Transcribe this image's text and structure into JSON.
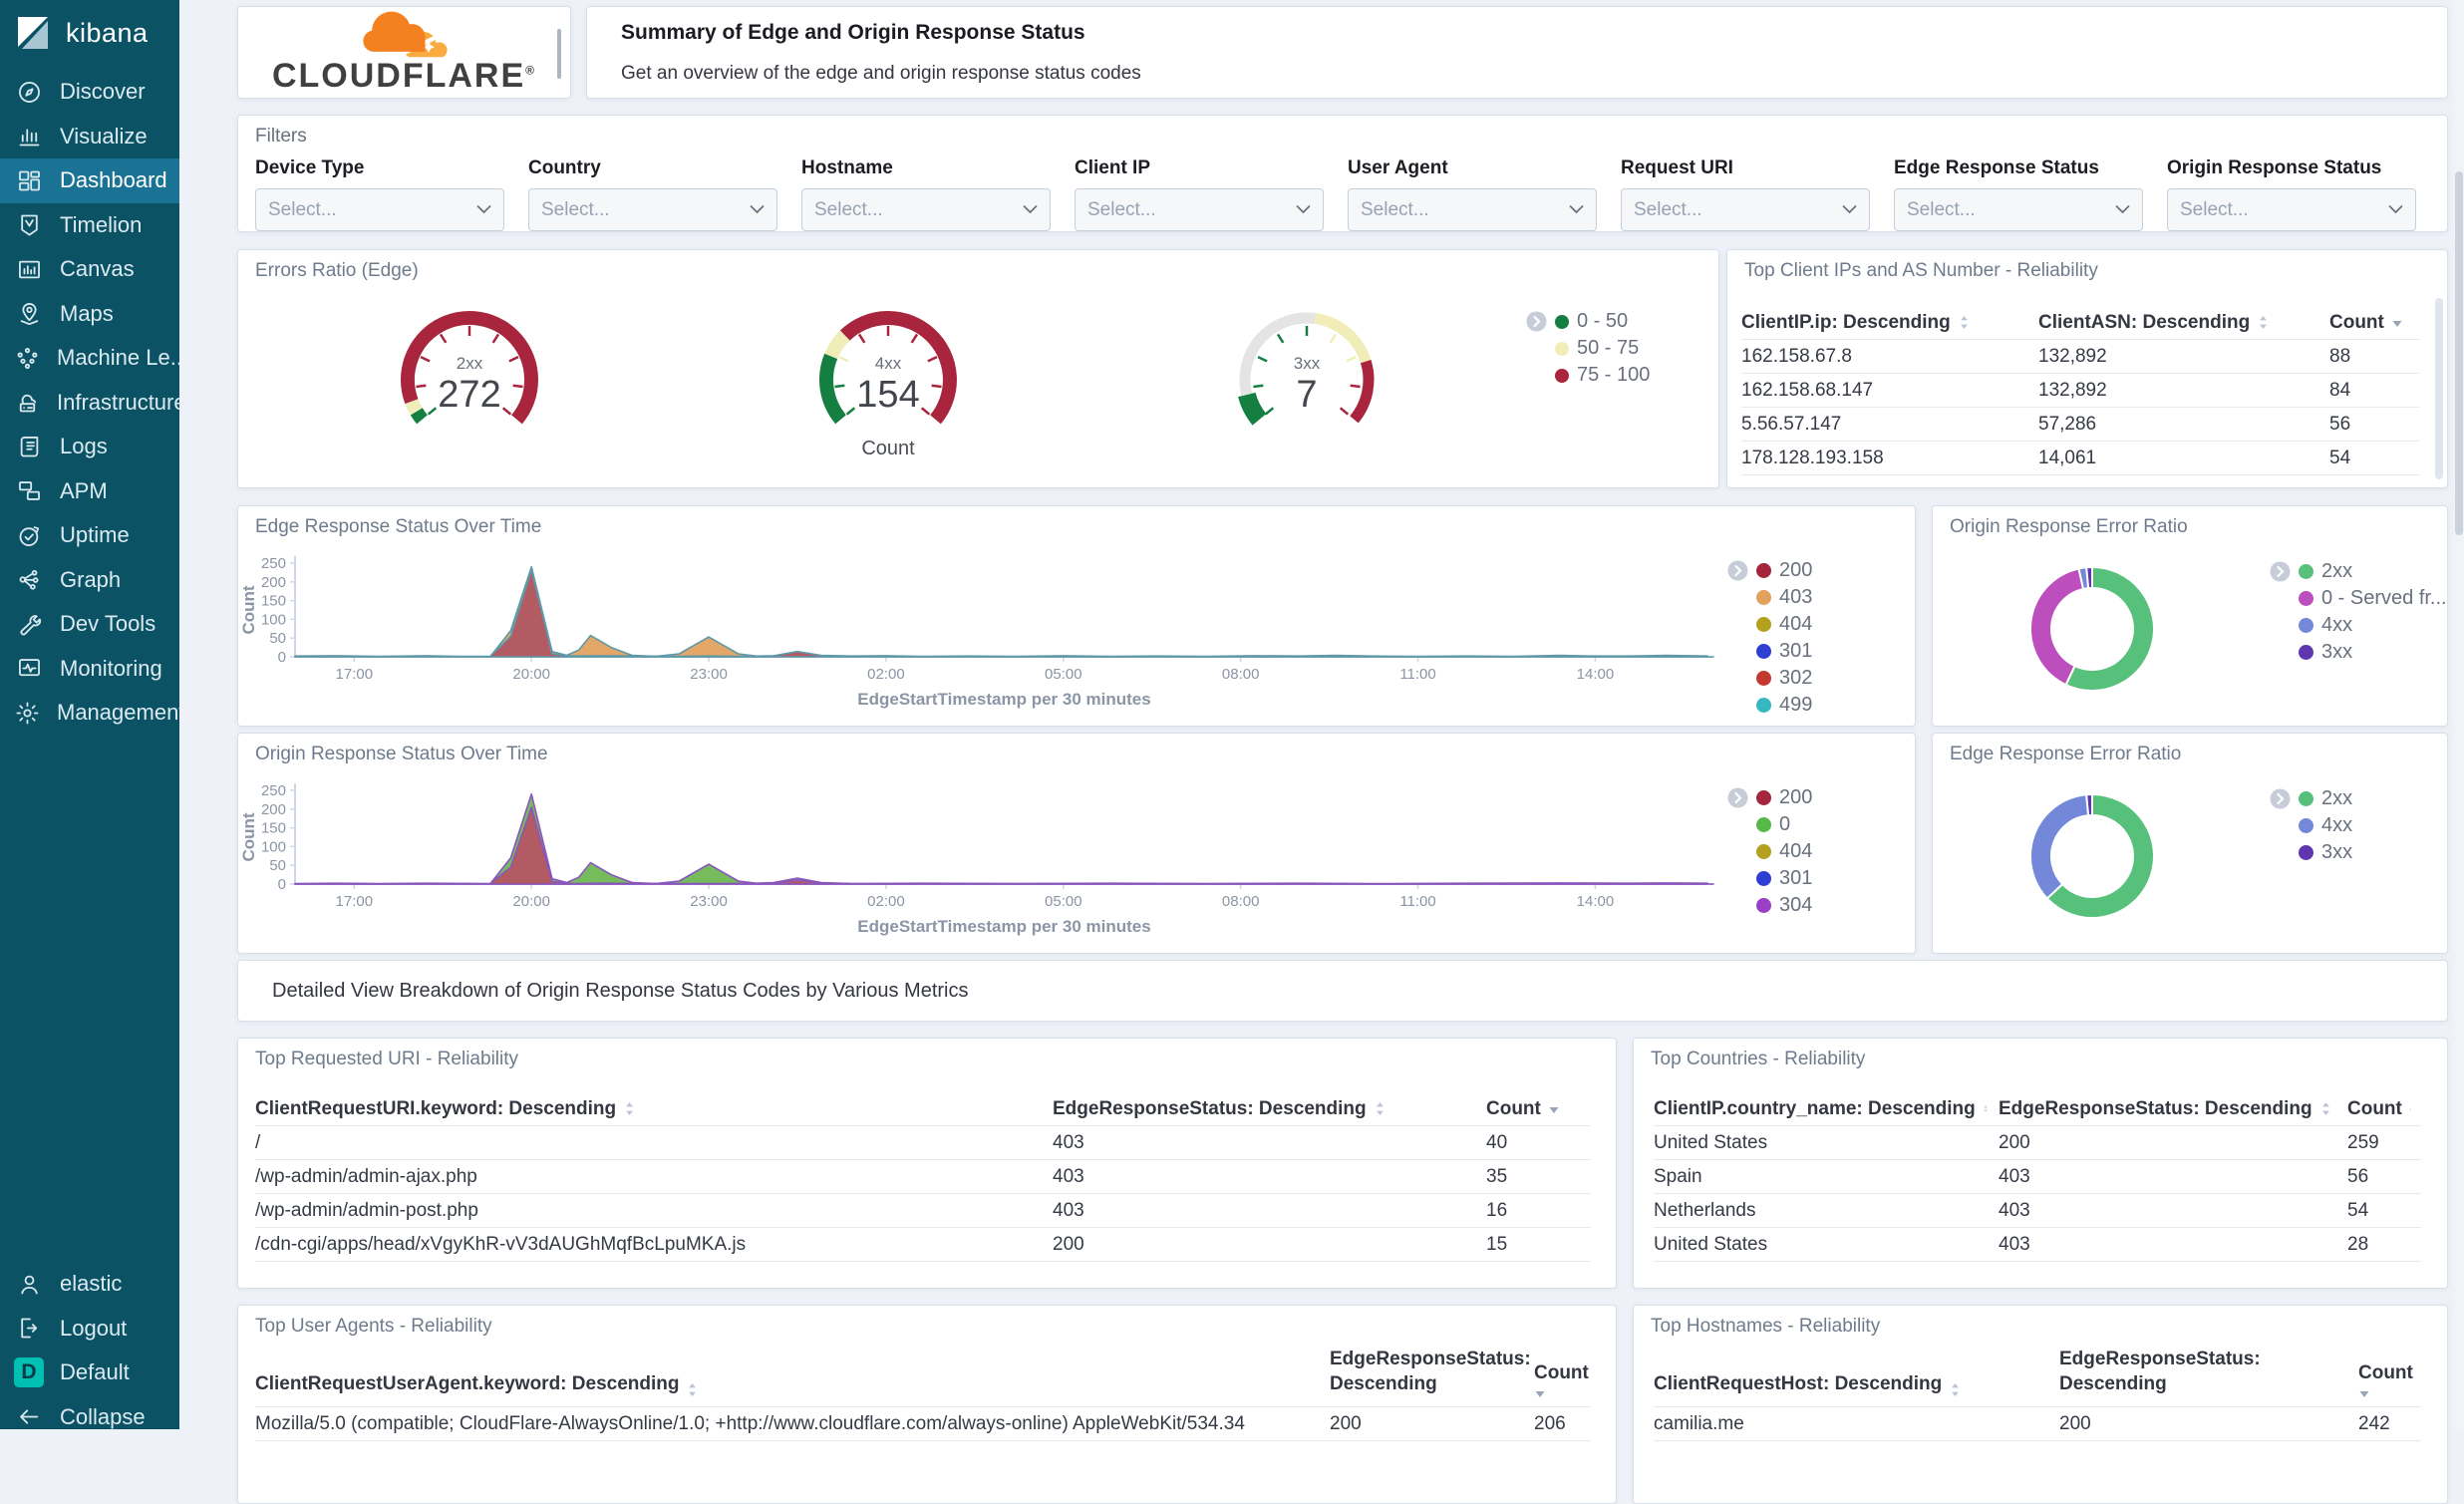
{
  "sidebar": {
    "brand": "kibana",
    "items": [
      {
        "label": "Discover",
        "icon": "discover-icon"
      },
      {
        "label": "Visualize",
        "icon": "visualize-icon"
      },
      {
        "label": "Dashboard",
        "icon": "dashboard-icon",
        "selected": true
      },
      {
        "label": "Timelion",
        "icon": "timelion-icon"
      },
      {
        "label": "Canvas",
        "icon": "canvas-icon"
      },
      {
        "label": "Maps",
        "icon": "maps-icon"
      },
      {
        "label": "Machine Le...",
        "icon": "machine-learning-icon"
      },
      {
        "label": "Infrastructure",
        "icon": "infrastructure-icon"
      },
      {
        "label": "Logs",
        "icon": "logs-icon"
      },
      {
        "label": "APM",
        "icon": "apm-icon"
      },
      {
        "label": "Uptime",
        "icon": "uptime-icon"
      },
      {
        "label": "Graph",
        "icon": "graph-icon"
      },
      {
        "label": "Dev Tools",
        "icon": "dev-tools-icon"
      },
      {
        "label": "Monitoring",
        "icon": "monitoring-icon"
      },
      {
        "label": "Management",
        "icon": "management-icon"
      }
    ],
    "footer_items": [
      {
        "label": "elastic",
        "icon": "user-icon"
      },
      {
        "label": "Logout",
        "icon": "logout-icon"
      },
      {
        "label": "Default",
        "icon": "default-badge"
      },
      {
        "label": "Collapse",
        "icon": "collapse-icon"
      }
    ]
  },
  "header": {
    "brand": "CLOUDFLARE",
    "brand_mark": "®",
    "title": "Summary of Edge and Origin Response Status",
    "subtitle": "Get an overview of the edge and origin response status codes"
  },
  "filters": {
    "title": "Filters",
    "fields": [
      {
        "label": "Device Type",
        "placeholder": "Select..."
      },
      {
        "label": "Country",
        "placeholder": "Select..."
      },
      {
        "label": "Hostname",
        "placeholder": "Select..."
      },
      {
        "label": "Client IP",
        "placeholder": "Select..."
      },
      {
        "label": "User Agent",
        "placeholder": "Select..."
      },
      {
        "label": "Request URI",
        "placeholder": "Select..."
      },
      {
        "label": "Edge Response Status",
        "placeholder": "Select..."
      },
      {
        "label": "Origin Response Status",
        "placeholder": "Select..."
      }
    ]
  },
  "chart_data": [
    {
      "id": "errors_ratio_edge",
      "type": "gauge",
      "title": "Errors Ratio (Edge)",
      "unit_label": "Count",
      "legend": [
        {
          "label": "0 - 50",
          "color": "#157f42"
        },
        {
          "label": "50 - 75",
          "color": "#f1edb9"
        },
        {
          "label": "75 - 100",
          "color": "#a8253d"
        }
      ],
      "gauges": [
        {
          "label": "2xx",
          "value": 272,
          "segments": [
            {
              "color": "#157f42",
              "from": 0,
              "to": 0.035
            },
            {
              "color": "#f1edb9",
              "from": 0.035,
              "to": 0.075
            },
            {
              "color": "#a8253d",
              "from": 0.075,
              "to": 1
            }
          ]
        },
        {
          "label": "4xx",
          "value": 154,
          "segments": [
            {
              "color": "#157f42",
              "from": 0,
              "to": 0.24
            },
            {
              "color": "#f1edb9",
              "from": 0.24,
              "to": 0.33
            },
            {
              "color": "#a8253d",
              "from": 0.33,
              "to": 1
            }
          ]
        },
        {
          "label": "3xx",
          "value": 7,
          "segments": [
            {
              "color": "#157f42",
              "from": 0,
              "to": 0.1,
              "filled": true
            },
            {
              "color": "#e4e4e4",
              "from": 0.1,
              "to": 0.53
            },
            {
              "color": "#f1edb9",
              "from": 0.53,
              "to": 0.78
            },
            {
              "color": "#a8253d",
              "from": 0.78,
              "to": 1
            }
          ]
        }
      ]
    },
    {
      "id": "edge_status_over_time",
      "type": "area",
      "title": "Edge Response Status Over Time",
      "xlabel": "EdgeStartTimestamp per 30 minutes",
      "ylabel": "Count",
      "x_ticks": [
        "17:00",
        "20:00",
        "23:00",
        "02:00",
        "05:00",
        "08:00",
        "11:00",
        "14:00"
      ],
      "x_tick_hours": [
        1,
        4,
        7,
        10,
        13,
        16,
        19,
        22
      ],
      "x_range_hours": [
        0,
        24
      ],
      "y_ticks": [
        0,
        50,
        100,
        150,
        200,
        250
      ],
      "ylim": [
        0,
        250
      ],
      "stroke": "#5f99a9",
      "legend": [
        {
          "label": "200",
          "color": "#a5253c"
        },
        {
          "label": "403",
          "color": "#e2a25c"
        },
        {
          "label": "404",
          "color": "#b3a01f"
        },
        {
          "label": "301",
          "color": "#2f3fd3"
        },
        {
          "label": "302",
          "color": "#c3392f"
        },
        {
          "label": "499",
          "color": "#35b8bf"
        }
      ],
      "series": [
        {
          "name": "403",
          "fill": "#e3a768",
          "points": [
            [
              0,
              0
            ],
            [
              3.3,
              0
            ],
            [
              3.65,
              70
            ],
            [
              4,
              240
            ],
            [
              4.35,
              14
            ],
            [
              4.6,
              4
            ],
            [
              4.8,
              18
            ],
            [
              5,
              57
            ],
            [
              5.35,
              25
            ],
            [
              5.7,
              4
            ],
            [
              6.1,
              1
            ],
            [
              6.5,
              8
            ],
            [
              7,
              53
            ],
            [
              7.5,
              8
            ],
            [
              7.8,
              2
            ],
            [
              8.2,
              1
            ],
            [
              9,
              0
            ],
            [
              24,
              0
            ]
          ]
        },
        {
          "name": "200",
          "fill": "#b25b63",
          "points": [
            [
              0,
              2
            ],
            [
              0.7,
              3
            ],
            [
              1.4,
              1
            ],
            [
              2.2,
              3
            ],
            [
              2.8,
              1
            ],
            [
              3.3,
              1
            ],
            [
              3.65,
              55
            ],
            [
              4,
              232
            ],
            [
              4.35,
              8
            ],
            [
              4.7,
              2
            ],
            [
              5.2,
              3
            ],
            [
              5.8,
              2
            ],
            [
              6.4,
              1
            ],
            [
              7,
              2
            ],
            [
              7.6,
              1
            ],
            [
              8.1,
              3
            ],
            [
              8.5,
              14
            ],
            [
              8.9,
              4
            ],
            [
              9.4,
              2
            ],
            [
              10,
              3
            ],
            [
              10.6,
              1
            ],
            [
              11.4,
              2
            ],
            [
              12.2,
              1
            ],
            [
              13,
              3
            ],
            [
              13.8,
              1
            ],
            [
              14.6,
              2
            ],
            [
              15.4,
              1
            ],
            [
              16.2,
              3
            ],
            [
              17,
              2
            ],
            [
              17.6,
              4
            ],
            [
              18.2,
              2
            ],
            [
              19,
              1
            ],
            [
              19.8,
              2
            ],
            [
              20.6,
              1
            ],
            [
              21.4,
              4
            ],
            [
              21.9,
              2
            ],
            [
              22.6,
              2
            ],
            [
              23.2,
              4
            ],
            [
              23.6,
              3
            ],
            [
              23.9,
              2
            ]
          ]
        }
      ]
    },
    {
      "id": "origin_response_error_ratio",
      "type": "pie",
      "title": "Origin Response Error Ratio",
      "donut": true,
      "slices": [
        {
          "label": "2xx",
          "value": 57,
          "color": "#57c17b"
        },
        {
          "label": "0 - Served fr...",
          "value": 39.5,
          "color": "#bd4ebd"
        },
        {
          "label": "4xx",
          "value": 2,
          "color": "#7388d8"
        },
        {
          "label": "3xx",
          "value": 1.5,
          "color": "#5f35b0"
        }
      ]
    },
    {
      "id": "origin_status_over_time",
      "type": "area",
      "title": "Origin Response Status Over Time",
      "xlabel": "EdgeStartTimestamp per 30 minutes",
      "ylabel": "Count",
      "x_ticks": [
        "17:00",
        "20:00",
        "23:00",
        "02:00",
        "05:00",
        "08:00",
        "11:00",
        "14:00"
      ],
      "x_tick_hours": [
        1,
        4,
        7,
        10,
        13,
        16,
        19,
        22
      ],
      "x_range_hours": [
        0,
        24
      ],
      "y_ticks": [
        0,
        50,
        100,
        150,
        200,
        250
      ],
      "ylim": [
        0,
        250
      ],
      "stroke": "#8a55bd",
      "legend": [
        {
          "label": "200",
          "color": "#a5253c"
        },
        {
          "label": "0",
          "color": "#55ba47"
        },
        {
          "label": "404",
          "color": "#b3a01f"
        },
        {
          "label": "301",
          "color": "#2f3fd3"
        },
        {
          "label": "304",
          "color": "#9b3fc7"
        }
      ],
      "series": [
        {
          "name": "0",
          "fill": "#76bc5c",
          "points": [
            [
              0,
              0
            ],
            [
              3.3,
              0
            ],
            [
              3.65,
              70
            ],
            [
              4,
              240
            ],
            [
              4.35,
              14
            ],
            [
              4.6,
              4
            ],
            [
              4.8,
              18
            ],
            [
              5,
              57
            ],
            [
              5.35,
              25
            ],
            [
              5.7,
              4
            ],
            [
              6.1,
              1
            ],
            [
              6.5,
              8
            ],
            [
              7,
              53
            ],
            [
              7.5,
              8
            ],
            [
              7.8,
              2
            ],
            [
              8.1,
              4
            ],
            [
              8.5,
              16
            ],
            [
              8.9,
              4
            ],
            [
              9.4,
              1
            ],
            [
              24,
              0
            ]
          ]
        },
        {
          "name": "200",
          "fill": "#b25b63",
          "points": [
            [
              0,
              1
            ],
            [
              0.7,
              2
            ],
            [
              1.4,
              1
            ],
            [
              2.2,
              2
            ],
            [
              3.3,
              1
            ],
            [
              3.65,
              45
            ],
            [
              4,
              205
            ],
            [
              4.35,
              6
            ],
            [
              4.7,
              1
            ],
            [
              5.2,
              2
            ],
            [
              6.4,
              1
            ],
            [
              7,
              1
            ],
            [
              8.1,
              2
            ],
            [
              8.5,
              11
            ],
            [
              8.9,
              3
            ],
            [
              9.4,
              1
            ],
            [
              10.6,
              2
            ],
            [
              12.2,
              1
            ],
            [
              13.8,
              2
            ],
            [
              15.4,
              1
            ],
            [
              17,
              2
            ],
            [
              18.2,
              1
            ],
            [
              19.8,
              2
            ],
            [
              21.4,
              3
            ],
            [
              22.6,
              2
            ],
            [
              23.2,
              3
            ],
            [
              23.9,
              2
            ]
          ]
        }
      ]
    },
    {
      "id": "edge_response_error_ratio",
      "type": "pie",
      "title": "Edge Response Error Ratio",
      "donut": true,
      "slices": [
        {
          "label": "2xx",
          "value": 63,
          "color": "#57c17b"
        },
        {
          "label": "4xx",
          "value": 35.5,
          "color": "#7388d8"
        },
        {
          "label": "3xx",
          "value": 1.5,
          "color": "#5f35b0"
        }
      ]
    }
  ],
  "tables": {
    "client_ips": {
      "title": "Top Client IPs and AS Number - Reliability",
      "columns": [
        "ClientIP.ip: Descending",
        "ClientASN: Descending",
        "Count"
      ],
      "rows": [
        [
          "162.158.67.8",
          "132,892",
          "88"
        ],
        [
          "162.158.68.147",
          "132,892",
          "84"
        ],
        [
          "5.56.57.147",
          "57,286",
          "56"
        ],
        [
          "178.128.193.158",
          "14,061",
          "54"
        ]
      ]
    },
    "top_uri": {
      "title": "Top Requested URI - Reliability",
      "columns": [
        "ClientRequestURI.keyword: Descending",
        "EdgeResponseStatus: Descending",
        "Count"
      ],
      "rows": [
        [
          "/",
          "403",
          "40"
        ],
        [
          "/wp-admin/admin-ajax.php",
          "403",
          "35"
        ],
        [
          "/wp-admin/admin-post.php",
          "403",
          "16"
        ],
        [
          "/cdn-cgi/apps/head/xVgyKhR-vV3dAUGhMqfBcLpuMKA.js",
          "200",
          "15"
        ]
      ]
    },
    "top_countries": {
      "title": "Top Countries - Reliability",
      "columns": [
        "ClientIP.country_name: Descending",
        "EdgeResponseStatus: Descending",
        "Count"
      ],
      "rows": [
        [
          "United States",
          "200",
          "259"
        ],
        [
          "Spain",
          "403",
          "56"
        ],
        [
          "Netherlands",
          "403",
          "54"
        ],
        [
          "United States",
          "403",
          "28"
        ]
      ]
    },
    "top_agents": {
      "title": "Top User Agents - Reliability",
      "columns": [
        "ClientRequestUserAgent.keyword: Descending",
        "EdgeResponseStatus: Descending",
        "Count"
      ],
      "rows": [
        [
          "Mozilla/5.0 (compatible; CloudFlare-AlwaysOnline/1.0; +http://www.cloudflare.com/always-online) AppleWebKit/534.34",
          "200",
          "206"
        ]
      ]
    },
    "top_hosts": {
      "title": "Top Hostnames - Reliability",
      "columns": [
        "ClientRequestHost: Descending",
        "EdgeResponseStatus: Descending",
        "Count"
      ],
      "rows": [
        [
          "camilia.me",
          "200",
          "242"
        ]
      ]
    }
  },
  "detail_banner": "Detailed View Breakdown of Origin Response Status Codes by Various Metrics"
}
